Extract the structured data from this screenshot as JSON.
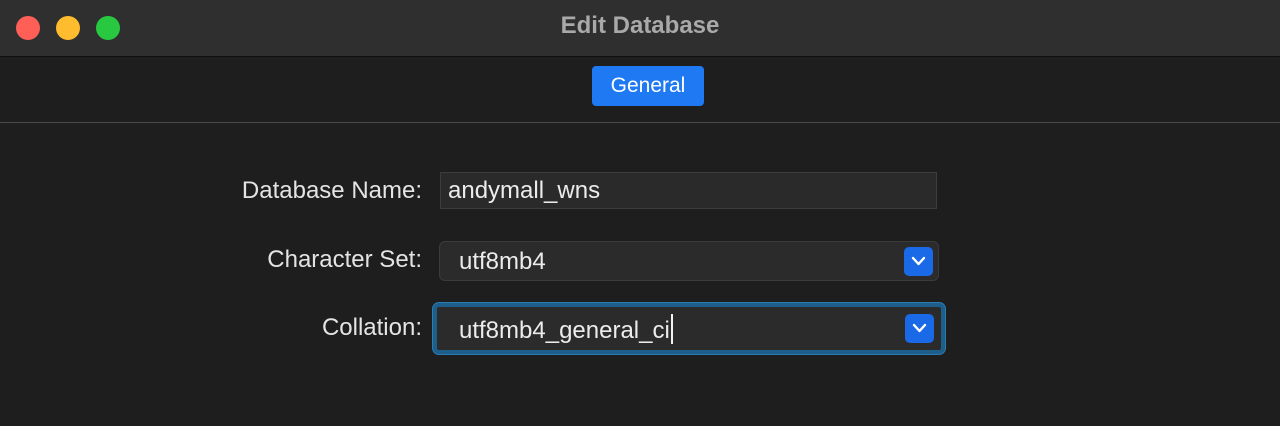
{
  "window": {
    "title": "Edit Database",
    "traffic_lights": {
      "close_color": "#fe5f57",
      "minimize_color": "#febc2e",
      "maximize_color": "#28c840"
    }
  },
  "tabs": {
    "active": "General",
    "items": [
      {
        "label": "General",
        "selected": true
      }
    ]
  },
  "form": {
    "database_name": {
      "label": "Database Name:",
      "value": "andymall_wns"
    },
    "character_set": {
      "label": "Character Set:",
      "value": "utf8mb4",
      "icon": "chevron-down-icon"
    },
    "collation": {
      "label": "Collation:",
      "value": "utf8mb4_general_ci",
      "icon": "chevron-down-icon",
      "focused": true
    }
  },
  "colors": {
    "accent": "#1f79f2",
    "focus_ring": "#1d5f8a",
    "background": "#1e1e1e",
    "titlebar": "#2f2f30"
  }
}
